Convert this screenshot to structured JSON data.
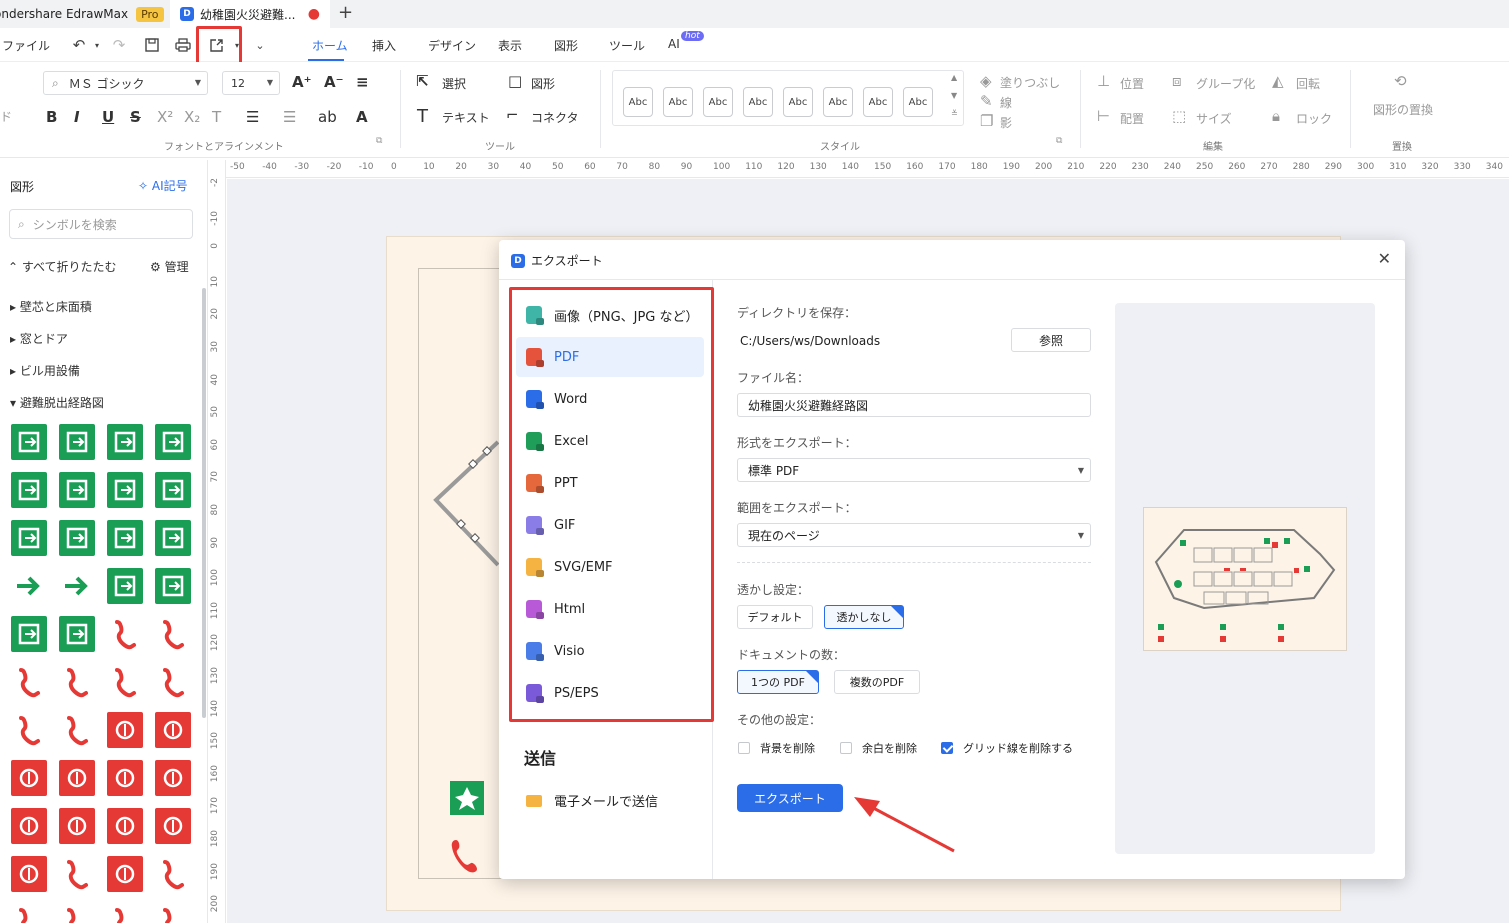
{
  "titlebar": {
    "app_name": "ondershare EdrawMax",
    "pro_badge": "Pro",
    "doc_tab_title": "幼稚園火災避難...",
    "unsaved_dot": "●",
    "new_tab": "+"
  },
  "menu": {
    "file": "ファイル",
    "tabs": [
      "ホーム",
      "挿入",
      "デザイン",
      "表示",
      "図形",
      "ツール",
      "AI"
    ],
    "hot_badge": "hot"
  },
  "ribbon": {
    "font_name": "ＭＳ ゴシック",
    "font_size": "12",
    "select_label": "選択",
    "shape_label": "図形",
    "text_label": "テキスト",
    "connector_label": "コネクタ",
    "style_abc": [
      "Abc",
      "Abc",
      "Abc",
      "Abc",
      "Abc",
      "Abc",
      "Abc",
      "Abc"
    ],
    "fill_label": "塗りつぶし",
    "line_label": "線",
    "shadow_label": "影",
    "position_label": "位置",
    "group_label": "グループ化",
    "rotate_label": "回転",
    "align_label": "配置",
    "size_label": "サイズ",
    "lock_label": "ロック",
    "replace_shape_label": "図形の置換",
    "group_font": "フォントとアラインメント",
    "group_tools": "ツール",
    "group_style": "スタイル",
    "group_edit": "編集",
    "group_replace": "置換",
    "left_cut_label": "ド"
  },
  "left_panel": {
    "title": "図形",
    "ai_symbol": "AI記号",
    "search_placeholder": "シンボルを検索",
    "collapse_all": "すべて折りたたむ",
    "manage": "管理",
    "categories": [
      "壁芯と床面積",
      "窓とドア",
      "ビル用設備",
      "避難脱出経路図"
    ]
  },
  "ruler": {
    "top": [
      "-50",
      "-40",
      "-30",
      "-20",
      "-10",
      "0",
      "10",
      "20",
      "30",
      "40",
      "50",
      "60",
      "70",
      "80",
      "90",
      "100",
      "110",
      "120",
      "130",
      "140",
      "150",
      "160",
      "170",
      "180",
      "190",
      "200",
      "210",
      "220",
      "230",
      "240",
      "250",
      "260",
      "270",
      "280",
      "290",
      "300",
      "310",
      "320",
      "330",
      "340"
    ],
    "left": [
      "-2",
      "-10",
      "0",
      "10",
      "20",
      "30",
      "40",
      "50",
      "60",
      "70",
      "80",
      "90",
      "100",
      "110",
      "120",
      "130",
      "140",
      "150",
      "160",
      "170",
      "180",
      "190",
      "200"
    ]
  },
  "dialog": {
    "title": "エクスポート",
    "formats": [
      "画像（PNG、JPG など）",
      "PDF",
      "Word",
      "Excel",
      "PPT",
      "GIF",
      "SVG/EMF",
      "Html",
      "Visio",
      "PS/EPS"
    ],
    "format_colors": [
      "#3fb5a8",
      "#e5533d",
      "#2b6de8",
      "#1f9e5a",
      "#e5683d",
      "#8b7de8",
      "#f5b342",
      "#b85ad8",
      "#4a7de8",
      "#7a5ad8"
    ],
    "selected_format": "PDF",
    "send_title": "送信",
    "send_email": "電子メールで送信",
    "dir_label": "ディレクトリを保存：",
    "dir_value": "C:/Users/ws/Downloads",
    "browse": "参照",
    "filename_label": "ファイル名：",
    "filename_value": "幼稚園火災避難経路図",
    "format_label": "形式をエクスポート：",
    "format_value": "標準 PDF",
    "range_label": "範囲をエクスポート：",
    "range_value": "現在のページ",
    "watermark_label": "透かし設定：",
    "watermark_default": "デフォルト",
    "watermark_none": "透かしなし",
    "doc_count_label": "ドキュメントの数：",
    "doc_single": "1つの PDF",
    "doc_multiple": "複数のPDF",
    "other_label": "その他の設定：",
    "opt_remove_bg": "背景を削除",
    "opt_remove_margin": "余白を削除",
    "opt_remove_grid": "グリッド線を削除する",
    "opt_remove_bg_checked": false,
    "opt_remove_margin_checked": false,
    "opt_remove_grid_checked": true,
    "export_button": "エクスポート"
  },
  "colors": {
    "accent": "#2b6de8",
    "highlight_red": "#e53935",
    "symbol_green": "#1a9e55",
    "symbol_red": "#e53935"
  }
}
